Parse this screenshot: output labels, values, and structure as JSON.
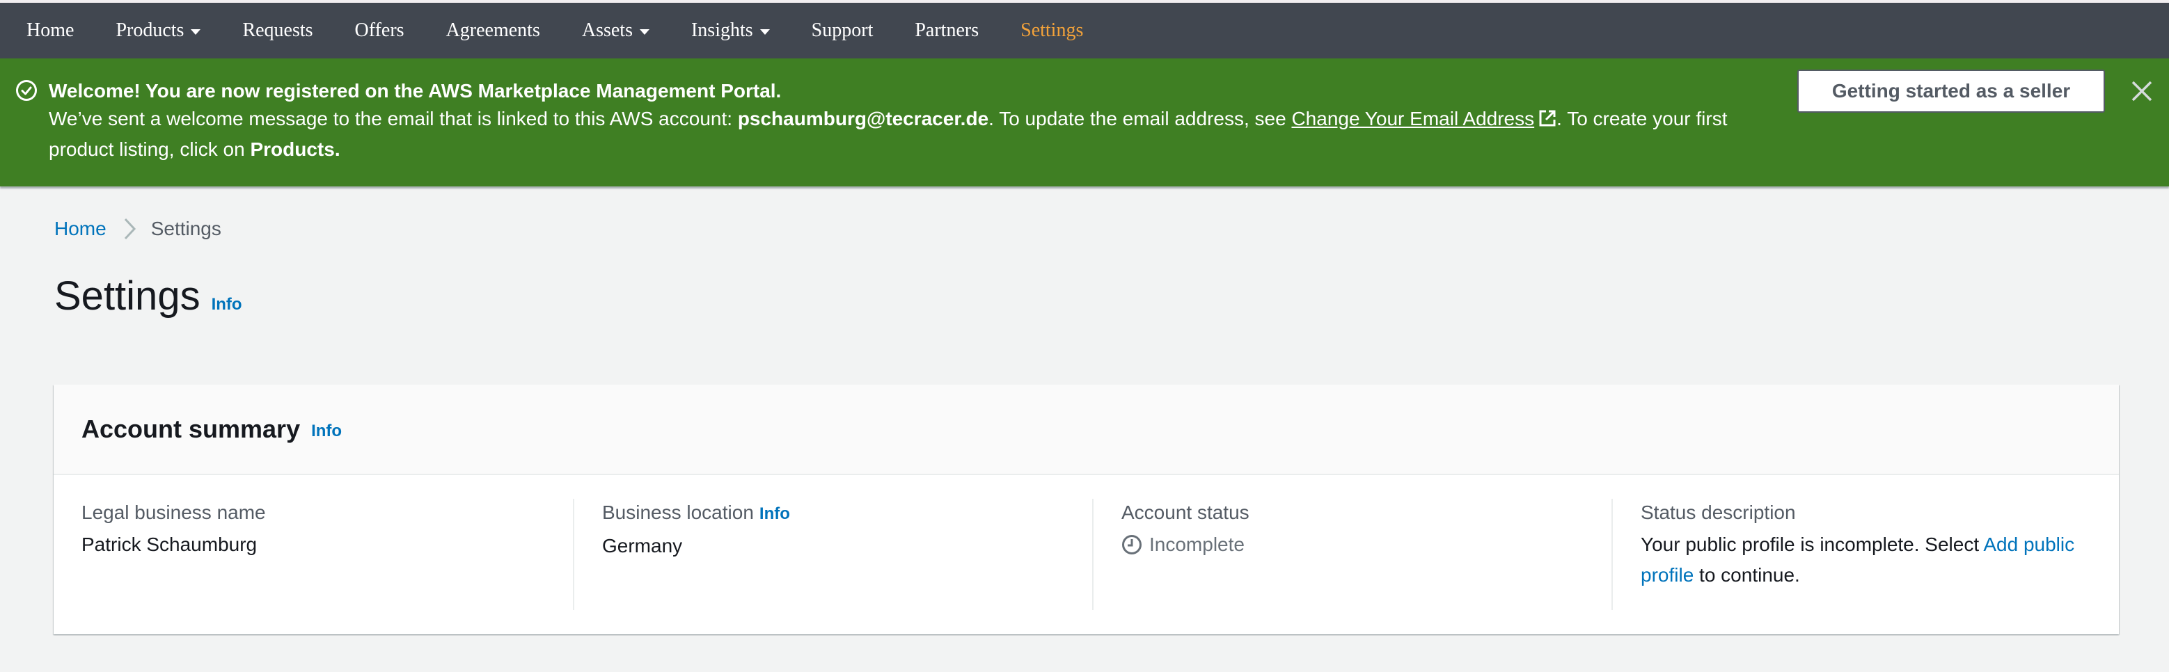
{
  "nav": {
    "items": [
      {
        "label": "Home",
        "dropdown": false,
        "active": false
      },
      {
        "label": "Products",
        "dropdown": true,
        "active": false
      },
      {
        "label": "Requests",
        "dropdown": false,
        "active": false
      },
      {
        "label": "Offers",
        "dropdown": false,
        "active": false
      },
      {
        "label": "Agreements",
        "dropdown": false,
        "active": false
      },
      {
        "label": "Assets",
        "dropdown": true,
        "active": false
      },
      {
        "label": "Insights",
        "dropdown": true,
        "active": false
      },
      {
        "label": "Support",
        "dropdown": false,
        "active": false
      },
      {
        "label": "Partners",
        "dropdown": false,
        "active": false
      },
      {
        "label": "Settings",
        "dropdown": false,
        "active": true
      }
    ]
  },
  "banner": {
    "icon": "check-circle-icon",
    "title": "Welcome! You are now registered on the AWS Marketplace Management Portal.",
    "body_prefix": "We’ve sent a welcome message to the email that is linked to this AWS account: ",
    "email": "pschaumburg@tecracer.de",
    "body_middle": ". To update the email address, see ",
    "link_label": "Change Your Email Address",
    "body_suffix": ". To create your first product listing, click on ",
    "products_label": "Products.",
    "button_label": "Getting started as a seller",
    "close_icon": "close-icon",
    "color": "#3f7f23"
  },
  "breadcrumb": {
    "home": "Home",
    "current": "Settings"
  },
  "page": {
    "title": "Settings",
    "info_label": "Info"
  },
  "account_summary": {
    "title": "Account summary",
    "info_label": "Info",
    "columns": [
      {
        "label": "Legal business name",
        "value": "Patrick Schaumburg"
      },
      {
        "label": "Business location",
        "info_label": "Info",
        "value": "Germany"
      },
      {
        "label": "Account status",
        "value": "Incomplete",
        "icon": "clock-icon"
      },
      {
        "label": "Status description",
        "value_prefix": "Your public profile is incomplete. Select ",
        "link_label": "Add public profile",
        "value_suffix": " to continue."
      }
    ]
  },
  "colors": {
    "nav_bg": "#414750",
    "nav_active": "#f2a23a",
    "link": "#0073bb",
    "page_bg": "#f2f3f3"
  }
}
